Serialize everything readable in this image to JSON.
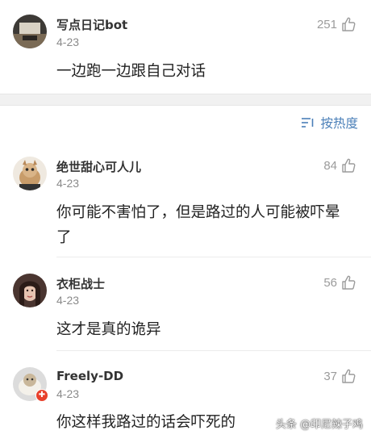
{
  "top_comment": {
    "user": "写点日记bot",
    "date": "4-23",
    "likes": "251",
    "text": "一边跑一边跟自己对话"
  },
  "sort": {
    "label": "按热度",
    "color": "#4a7fb8"
  },
  "comments": [
    {
      "user": "绝世甜心可人儿",
      "date": "4-23",
      "likes": "84",
      "text": "你可能不害怕了，但是路过的人可能被吓晕了"
    },
    {
      "user": "衣柜战士",
      "date": "4-23",
      "likes": "56",
      "text": "这才是真的诡异"
    },
    {
      "user": "Freely-DD",
      "date": "4-23",
      "likes": "37",
      "text": "你这样我路过的话会吓死的"
    }
  ],
  "watermark": "头条 @印尼辣子鸡",
  "icons": {
    "like": "thumb-up-icon",
    "sort": "sort-lines-icon",
    "badge": "red-dot-badge"
  }
}
